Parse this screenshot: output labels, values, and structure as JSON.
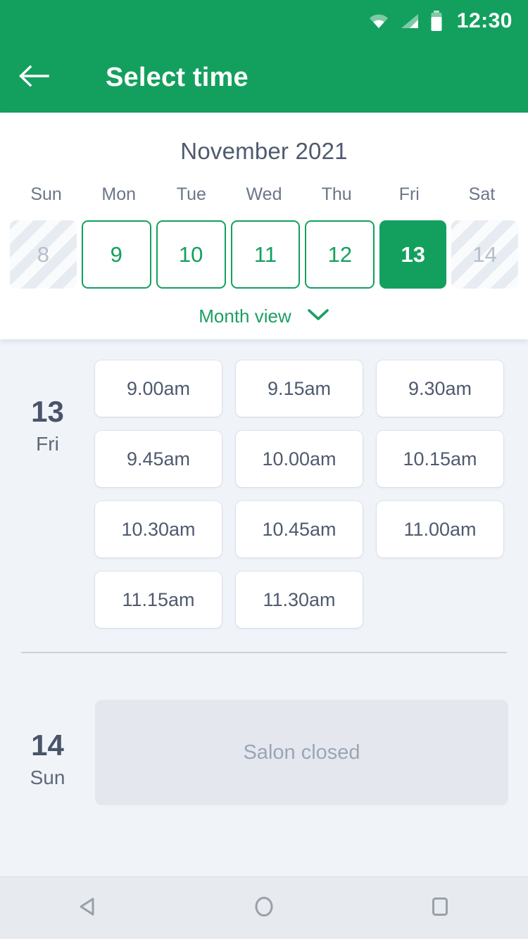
{
  "status_bar": {
    "time": "12:30",
    "icons": [
      "wifi-icon",
      "signal-icon",
      "battery-icon"
    ]
  },
  "app_bar": {
    "back_icon": "back-arrow-icon",
    "title": "Select time"
  },
  "calendar": {
    "month_title": "November 2021",
    "weekday_headers": [
      "Sun",
      "Mon",
      "Tue",
      "Wed",
      "Thu",
      "Fri",
      "Sat"
    ],
    "days": [
      {
        "number": "8",
        "state": "disabled"
      },
      {
        "number": "9",
        "state": "available"
      },
      {
        "number": "10",
        "state": "available"
      },
      {
        "number": "11",
        "state": "available"
      },
      {
        "number": "12",
        "state": "available"
      },
      {
        "number": "13",
        "state": "selected"
      },
      {
        "number": "14",
        "state": "disabled"
      }
    ],
    "month_view_label": "Month view",
    "month_view_chevron": "chevron-down-icon"
  },
  "day_groups": [
    {
      "date_number": "13",
      "day_of_week": "Fri",
      "slots": [
        "9.00am",
        "9.15am",
        "9.30am",
        "9.45am",
        "10.00am",
        "10.15am",
        "10.30am",
        "10.45am",
        "11.00am",
        "11.15am",
        "11.30am"
      ]
    },
    {
      "date_number": "14",
      "day_of_week": "Sun",
      "closed_message": "Salon closed"
    }
  ],
  "nav_bar": {
    "back_label": "back-triangle-icon",
    "home_label": "home-circle-icon",
    "recents_label": "recents-square-icon"
  },
  "colors": {
    "brand_green": "#13A05E",
    "background": "#F0F3F8",
    "text_dark": "#4A5468",
    "text_muted": "#9BA5B5"
  }
}
